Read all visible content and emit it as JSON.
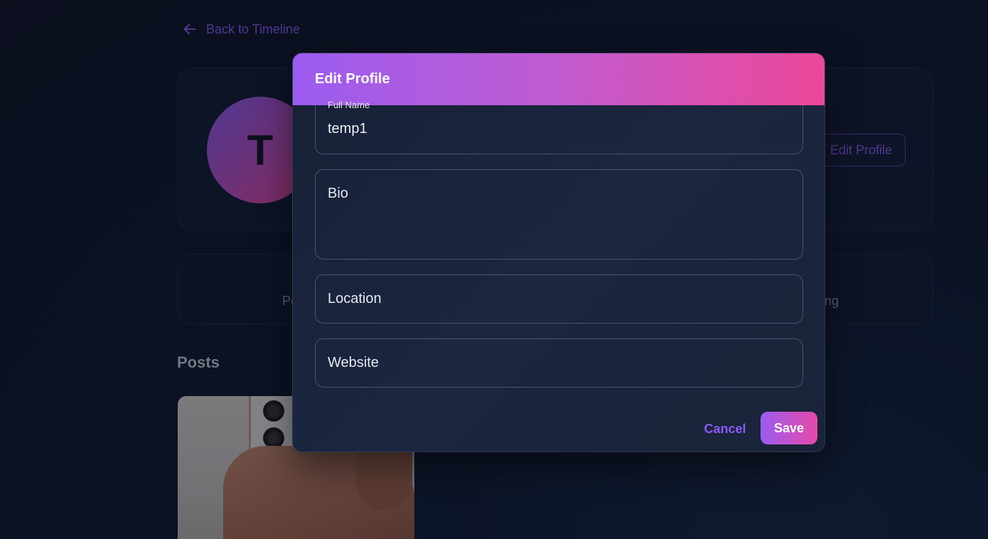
{
  "page": {
    "back_link": "Back to Timeline",
    "avatar_initial": "T",
    "edit_profile_label": "Edit Profile",
    "stat_left_fragment": "Po",
    "stat_right_fragment": "ng",
    "posts_heading": "Posts"
  },
  "modal": {
    "title": "Edit Profile",
    "full_name": {
      "label": "Full Name",
      "value": "temp1"
    },
    "bio": {
      "placeholder": "Bio"
    },
    "location": {
      "placeholder": "Location"
    },
    "website": {
      "placeholder": "Website"
    },
    "cancel_label": "Cancel",
    "save_label": "Save"
  },
  "colors": {
    "accent": "#8b5cf6",
    "gradient_start": "#9c5cf0",
    "gradient_end": "#ec4899"
  },
  "icons": {
    "back": "arrow-left-icon"
  }
}
